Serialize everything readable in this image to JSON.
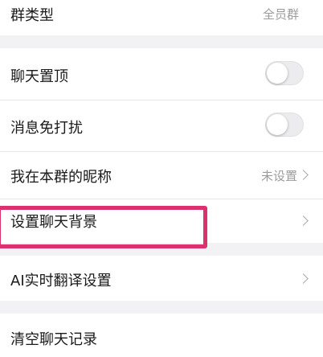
{
  "group_type": {
    "label": "群类型",
    "value": "全员群"
  },
  "pin_chat": {
    "label": "聊天置顶",
    "enabled": false
  },
  "mute": {
    "label": "消息免打扰",
    "enabled": false
  },
  "nickname": {
    "label": "我在本群的昵称",
    "value": "未设置"
  },
  "chat_background": {
    "label": "设置聊天背景"
  },
  "ai_translate": {
    "label": "AI实时翻译设置"
  },
  "clear_history": {
    "label": "清空聊天记录"
  },
  "colors": {
    "highlight": "#d9326e",
    "background": "#f2f2f4"
  }
}
